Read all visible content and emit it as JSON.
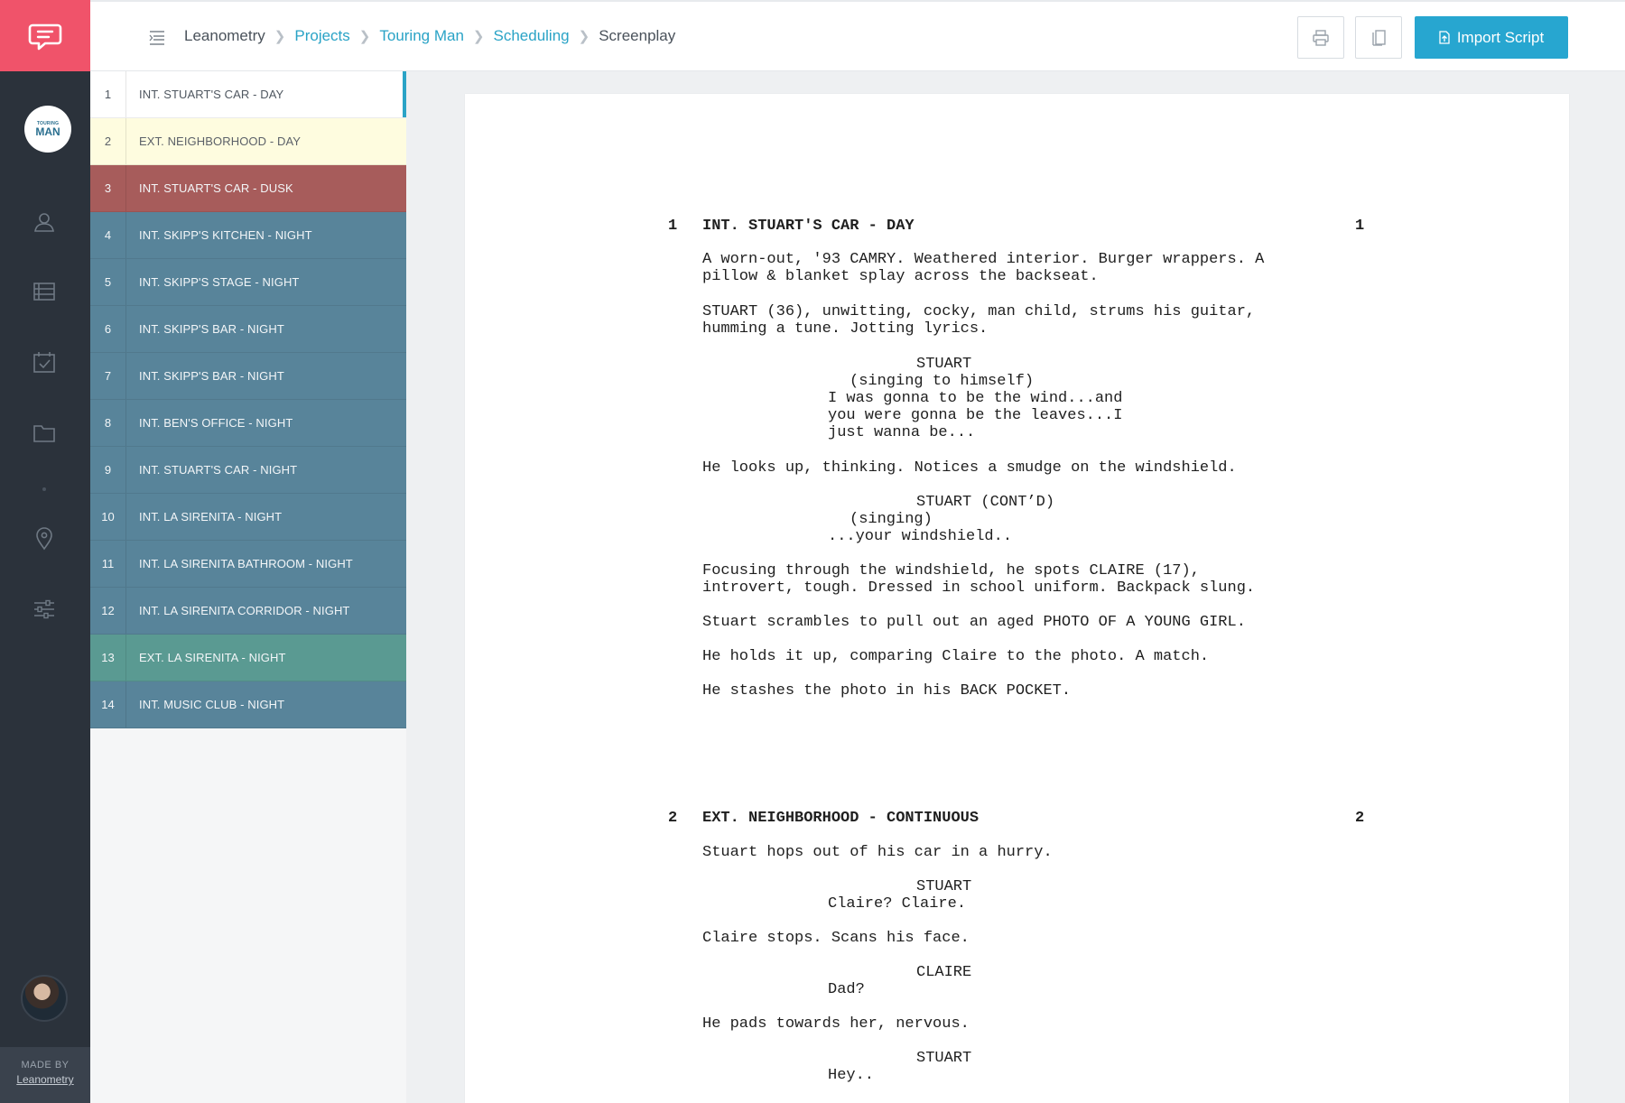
{
  "rail": {
    "project_logo_small": "TOURING",
    "project_logo_large": "MAN",
    "made_by": "MADE BY",
    "made_by_brand": "Leanometry"
  },
  "breadcrumbs": [
    {
      "label": "Leanometry"
    },
    {
      "label": "Projects"
    },
    {
      "label": "Touring Man"
    },
    {
      "label": "Scheduling"
    },
    {
      "label": "Screenplay"
    }
  ],
  "toolbar": {
    "import_label": "Import Script"
  },
  "scenes": [
    {
      "num": "1",
      "label": "INT. STUART'S CAR - DAY"
    },
    {
      "num": "2",
      "label": "EXT. NEIGHBORHOOD - DAY"
    },
    {
      "num": "3",
      "label": "INT. STUART'S CAR - DUSK"
    },
    {
      "num": "4",
      "label": "INT. SKIPP'S KITCHEN - NIGHT"
    },
    {
      "num": "5",
      "label": "INT. SKIPP'S STAGE - NIGHT"
    },
    {
      "num": "6",
      "label": "INT. SKIPP'S BAR - NIGHT"
    },
    {
      "num": "7",
      "label": "INT. SKIPP'S BAR - NIGHT"
    },
    {
      "num": "8",
      "label": "INT. BEN'S OFFICE - NIGHT"
    },
    {
      "num": "9",
      "label": "INT. STUART'S CAR - NIGHT"
    },
    {
      "num": "10",
      "label": "INT. LA SIRENITA - NIGHT"
    },
    {
      "num": "11",
      "label": "INT. LA SIRENITA BATHROOM - NIGHT"
    },
    {
      "num": "12",
      "label": "INT. LA SIRENITA CORRIDOR - NIGHT"
    },
    {
      "num": "13",
      "label": "EXT. LA SIRENITA - NIGHT"
    },
    {
      "num": "14",
      "label": "INT. MUSIC CLUB - NIGHT"
    }
  ],
  "script": {
    "s1_num": "1",
    "s1_heading": "INT. STUART'S CAR - DAY",
    "s1_a1": "A worn-out, '93 CAMRY. Weathered interior. Burger wrappers. A\npillow & blanket splay across the backseat.",
    "s1_a2": "STUART (36), unwitting, cocky, man child, strums his guitar,\nhumming a tune. Jotting lyrics.",
    "s1_c1": "STUART",
    "s1_p1": "(singing to himself)",
    "s1_d1": "I was gonna to be the wind...and\nyou were gonna be the leaves...I\njust wanna be...",
    "s1_a3": "He looks up, thinking. Notices a smudge on the windshield.",
    "s1_c2": "STUART (CONT’D)",
    "s1_p2": "(singing)",
    "s1_d2": "...your windshield..",
    "s1_a4": "Focusing through the windshield, he spots CLAIRE (17),\nintrovert, tough. Dressed in school uniform. Backpack slung.",
    "s1_a5": "Stuart scrambles to pull out an aged PHOTO OF A YOUNG GIRL.",
    "s1_a6": "He holds it up, comparing Claire to the photo. A match.",
    "s1_a7": "He stashes the photo in his BACK POCKET.",
    "s2_num": "2",
    "s2_heading": "EXT. NEIGHBORHOOD - CONTINUOUS",
    "s2_a1": "Stuart hops out of his car in a hurry.",
    "s2_c1": "STUART",
    "s2_d1": "Claire? Claire.",
    "s2_a2": "Claire stops. Scans his face.",
    "s2_c2": "CLAIRE",
    "s2_d2": "Dad?",
    "s2_a3": "He pads towards her, nervous.",
    "s2_c3": "STUART",
    "s2_d3": "Hey.."
  },
  "colors": {
    "brand": "#f0536a",
    "accent": "#27a6d0",
    "rail": "#2b323b",
    "scene_yellow": "#fefcdf",
    "scene_red": "#a75c5b",
    "scene_blue": "#58849a",
    "scene_teal": "#5a9a92"
  },
  "icons": [
    "chat-logo-icon",
    "cast-icon",
    "breakdown-list-icon",
    "calendar-check-icon",
    "folder-icon",
    "location-pin-icon",
    "sliders-icon",
    "menu-lines-icon",
    "printer-icon",
    "pages-icon",
    "upload-file-icon"
  ]
}
